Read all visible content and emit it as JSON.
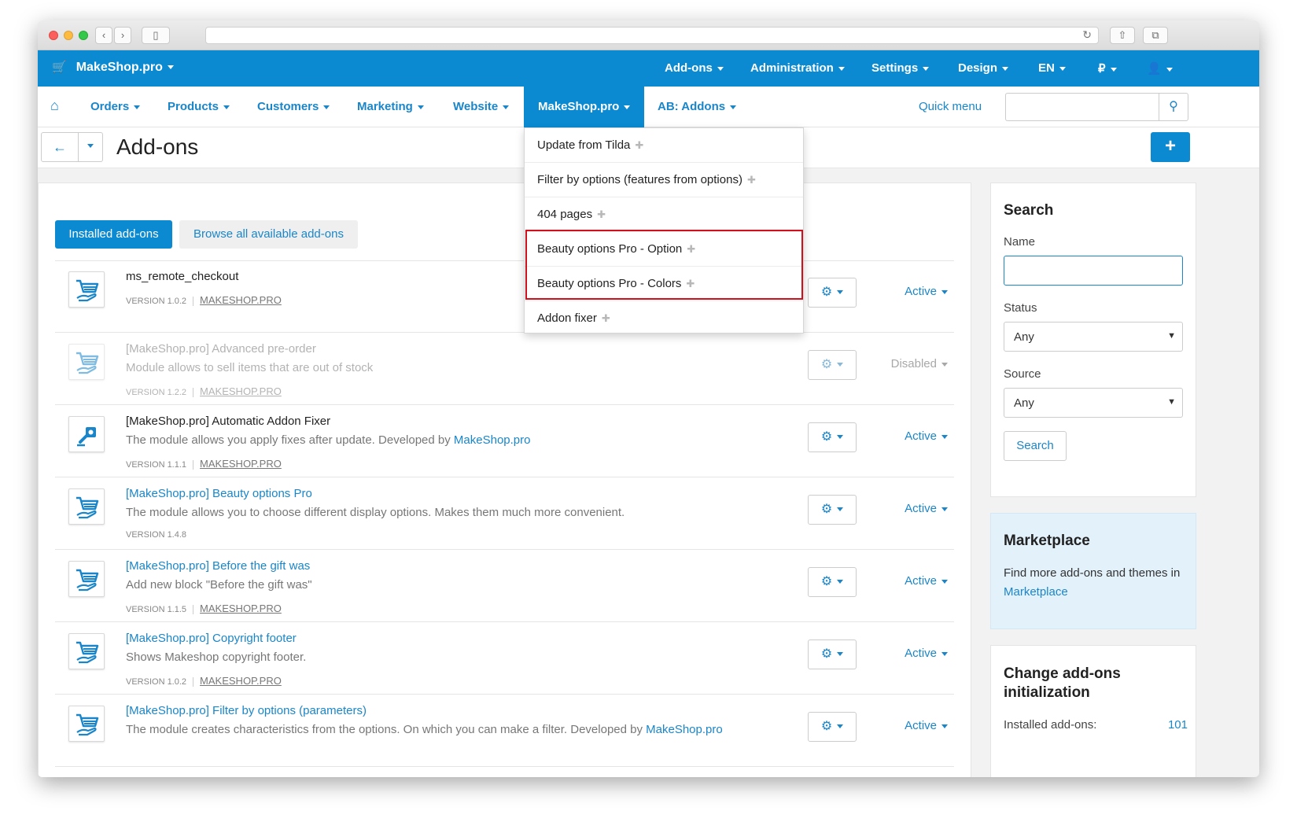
{
  "topbar": {
    "brand": "MakeShop.pro",
    "items": [
      "Add-ons",
      "Administration",
      "Settings",
      "Design",
      "EN",
      "₽",
      ""
    ]
  },
  "subnav": {
    "items": [
      "Orders",
      "Products",
      "Customers",
      "Marketing",
      "Website"
    ],
    "active": "MakeShop.pro",
    "ab_addons": "AB: Addons",
    "quick_menu": "Quick menu"
  },
  "page": {
    "title": "Add-ons"
  },
  "tabs": {
    "installed": "Installed add-ons",
    "browse": "Browse all available add-ons"
  },
  "dropdown": {
    "items": [
      "Update from Tilda",
      "Filter by options (features from options)",
      "404 pages",
      "Beauty options Pro - Option",
      "Beauty options Pro - Colors",
      "Addon fixer"
    ]
  },
  "addons": [
    {
      "name": "ms_remote_checkout",
      "desc": "",
      "desc_link": "",
      "version": "VERSION 1.0.2",
      "vendor": "MAKESHOP.PRO",
      "status": "Active"
    },
    {
      "name": "[MakeShop.pro] Advanced pre-order",
      "desc": "Module allows to sell items that are out of stock",
      "desc_link": "",
      "version": "VERSION 1.2.2",
      "vendor": "MAKESHOP.PRO",
      "status": "Disabled"
    },
    {
      "name": "[MakeShop.pro] Automatic Addon Fixer",
      "desc": "The module allows you apply fixes after update. Developed by ",
      "desc_link": "MakeShop.pro",
      "version": "VERSION 1.1.1",
      "vendor": "MAKESHOP.PRO",
      "status": "Active"
    },
    {
      "name": "[MakeShop.pro] Beauty options Pro",
      "desc": "The module allows you to choose different display options. Makes them much more convenient.",
      "desc_link": "",
      "version": "VERSION 1.4.8",
      "vendor": "",
      "status": "Active"
    },
    {
      "name": "[MakeShop.pro] Before the gift was",
      "desc": "Add new block \"Before the gift was\"",
      "desc_link": "",
      "version": "VERSION 1.1.5",
      "vendor": "MAKESHOP.PRO",
      "status": "Active"
    },
    {
      "name": "[MakeShop.pro] Copyright footer",
      "desc": "Shows Makeshop copyright footer.",
      "desc_link": "",
      "version": "VERSION 1.0.2",
      "vendor": "MAKESHOP.PRO",
      "status": "Active"
    },
    {
      "name": "[MakeShop.pro] Filter by options (parameters)",
      "desc": "The module creates characteristics from the options. On which you can make a filter. Developed by ",
      "desc_link": "MakeShop.pro",
      "version": "",
      "vendor": "",
      "status": "Active"
    }
  ],
  "sidebar": {
    "search_title": "Search",
    "name_label": "Name",
    "status_label": "Status",
    "status_value": "Any",
    "source_label": "Source",
    "source_value": "Any",
    "search_button": "Search",
    "marketplace_title": "Marketplace",
    "marketplace_text": "Find more add-ons and themes in ",
    "marketplace_link": "Marketplace",
    "change_title": "Change add-ons initialization",
    "installed_label": "Installed add-ons:",
    "installed_count": "101"
  }
}
